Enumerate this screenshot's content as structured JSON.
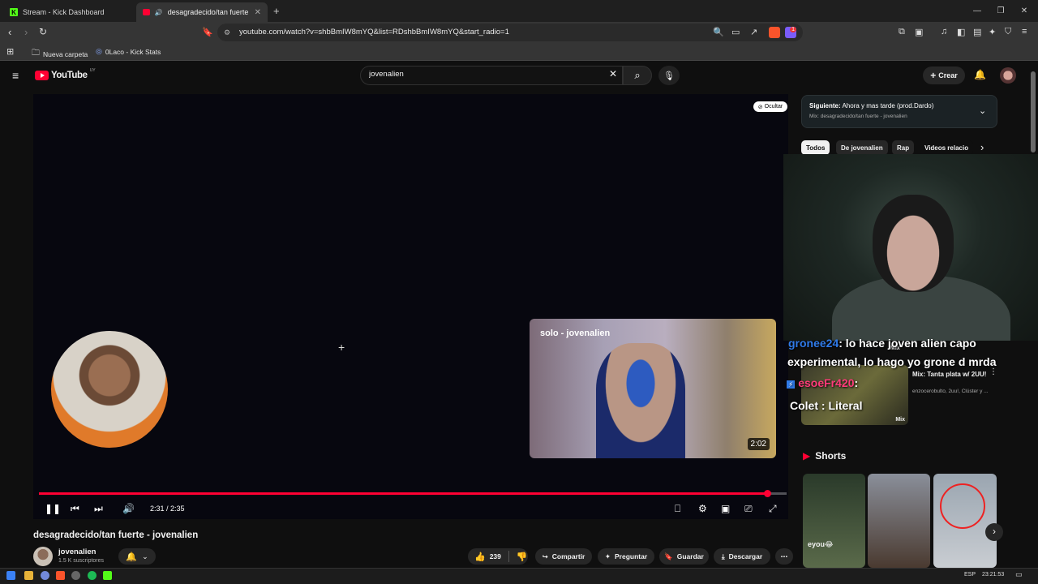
{
  "browser": {
    "tabs": [
      {
        "title": "Stream - Kick Dashboard",
        "active": false
      },
      {
        "title": "desagradecido/tan fuerte - jo",
        "active": true
      }
    ],
    "url": "youtube.com/watch?v=shbBmIW8mYQ&list=RDshbBmIW8mYQ&start_radio=1",
    "bookmarks": [
      "Nueva carpeta",
      "0Laco - Kick Stats"
    ],
    "extension_badge": "1"
  },
  "youtube": {
    "logo_text": "YouTube",
    "region": "UY",
    "search_value": "jovenalien",
    "create_label": "Crear"
  },
  "player": {
    "hide_label": "Ocultar",
    "pip_title": "solo - jovenalien",
    "pip_duration": "2:02",
    "time": "2:31 / 2:35",
    "progress": 0.974
  },
  "video": {
    "title": "desagradecido/tan fuerte - jovenalien",
    "channel": "jovenalien",
    "subscribers": "1.5 K suscriptores",
    "likes": "239",
    "actions": [
      "Compartir",
      "Preguntar",
      "Guardar",
      "Descargar"
    ]
  },
  "sidebar": {
    "next_label": "Siguiente:",
    "next_title": "Ahora y mas tarde (prod.Dardo)",
    "next_sub": "Mix: desagradecido/tan fuerte - jovenalien",
    "chips": [
      "Todos",
      "De jovenalien",
      "Rap",
      "Videos relacio"
    ],
    "related": {
      "mix_badge": "Mix",
      "title": "Mix: Tanta plata w/ 2UU!",
      "meta": "enzocerobulto, 2uu!, Clúster y ..."
    },
    "shorts_heading": "Shorts",
    "short_caption": "eyou😂"
  },
  "overlay_chat": [
    {
      "user": "gronee24",
      "text": ": lo hace joven alien capo"
    },
    {
      "user": "",
      "text": "experimental, lo hago yo grone d mrda"
    },
    {
      "user": "esoeFr420",
      "text": ":"
    },
    {
      "user": "Colet",
      "text": " : Literal"
    }
  ],
  "taskbar": {
    "lang": "ESP",
    "clock": "23:21:53"
  },
  "colors": {
    "youtube_red": "#ff0033",
    "kick_green": "#53fc18",
    "background": "#0f0f0f"
  }
}
